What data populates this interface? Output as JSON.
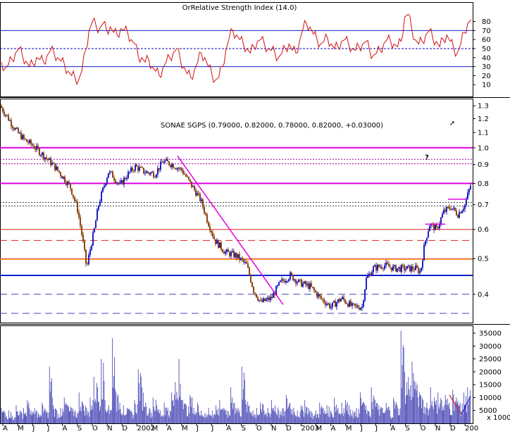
{
  "rsi_panel": {
    "title": "OrRelative Strength Index (14.0)",
    "ticks": [
      "80",
      "70",
      "60",
      "50",
      "40",
      "30",
      "20",
      "10"
    ],
    "tick_values": [
      80,
      70,
      60,
      50,
      40,
      30,
      20,
      10
    ]
  },
  "price_panel": {
    "title": "SONAE SGPS (0.79000, 0.82000, 0.78000, 0.82000, +0.03000)",
    "ticks": [
      "1.3",
      "1.2",
      "1.1",
      "1.0",
      "0.9",
      "0.8",
      "0.7",
      "0.6",
      "0.5",
      "0.4"
    ],
    "tick_values": [
      1.3,
      1.2,
      1.1,
      1.0,
      0.9,
      0.8,
      0.7,
      0.6,
      0.5,
      0.4
    ],
    "question_mark": "?",
    "arrow_glyph": "➚"
  },
  "volume_panel": {
    "ticks": [
      "35000",
      "30000",
      "25000",
      "20000",
      "15000",
      "10000",
      "5000"
    ],
    "tick_values": [
      35000,
      30000,
      25000,
      20000,
      15000,
      10000,
      5000
    ],
    "unit_label": "x 1000"
  },
  "x_axis": {
    "labels": [
      "A",
      "M",
      "J",
      "J",
      "A",
      "S",
      "O",
      "N",
      "D",
      "2002",
      "M",
      "A",
      "M",
      "J",
      "J",
      "A",
      "S",
      "O",
      "N",
      "D",
      "2003",
      "M",
      "A",
      "M",
      "J",
      "J",
      "A",
      "S",
      "O",
      "N",
      "D",
      "200"
    ]
  },
  "chart_data": {
    "type": "candlestick",
    "title": "SONAE SGPS (0.79000, 0.82000, 0.78000, 0.82000, +0.03000)",
    "last_bar": {
      "open": 0.79,
      "high": 0.82,
      "low": 0.78,
      "close": 0.82,
      "change": 0.03
    },
    "price_scale": "log",
    "price_range": [
      0.335,
      1.36
    ],
    "price_path": [
      [
        0,
        1.3
      ],
      [
        12,
        1.2
      ],
      [
        18,
        1.15
      ],
      [
        25,
        1.1
      ],
      [
        35,
        1.05
      ],
      [
        45,
        1.02
      ],
      [
        60,
        0.96
      ],
      [
        75,
        0.9
      ],
      [
        90,
        0.83
      ],
      [
        100,
        0.78
      ],
      [
        110,
        0.68
      ],
      [
        118,
        0.55
      ],
      [
        123,
        0.47
      ],
      [
        128,
        0.53
      ],
      [
        134,
        0.6
      ],
      [
        140,
        0.7
      ],
      [
        147,
        0.78
      ],
      [
        154,
        0.86
      ],
      [
        160,
        0.84
      ],
      [
        170,
        0.79
      ],
      [
        180,
        0.84
      ],
      [
        192,
        0.89
      ],
      [
        205,
        0.86
      ],
      [
        220,
        0.85
      ],
      [
        232,
        0.92
      ],
      [
        245,
        0.9
      ],
      [
        258,
        0.87
      ],
      [
        272,
        0.79
      ],
      [
        285,
        0.72
      ],
      [
        295,
        0.63
      ],
      [
        305,
        0.56
      ],
      [
        320,
        0.52
      ],
      [
        335,
        0.51
      ],
      [
        350,
        0.48
      ],
      [
        360,
        0.41
      ],
      [
        370,
        0.38
      ],
      [
        385,
        0.39
      ],
      [
        398,
        0.43
      ],
      [
        412,
        0.45
      ],
      [
        425,
        0.43
      ],
      [
        440,
        0.42
      ],
      [
        455,
        0.39
      ],
      [
        470,
        0.37
      ],
      [
        485,
        0.39
      ],
      [
        500,
        0.37
      ],
      [
        514,
        0.37
      ],
      [
        520,
        0.44
      ],
      [
        530,
        0.47
      ],
      [
        545,
        0.48
      ],
      [
        560,
        0.47
      ],
      [
        575,
        0.47
      ],
      [
        590,
        0.47
      ],
      [
        597,
        0.46
      ],
      [
        603,
        0.55
      ],
      [
        610,
        0.62
      ],
      [
        620,
        0.6
      ],
      [
        630,
        0.67
      ],
      [
        640,
        0.69
      ],
      [
        650,
        0.66
      ],
      [
        660,
        0.7
      ],
      [
        668,
        0.79
      ],
      [
        671,
        0.82
      ]
    ],
    "horizontal_levels": [
      {
        "value": 1.0,
        "color": "#e000e0",
        "style": "solid",
        "width": 2
      },
      {
        "value": 0.93,
        "color": "#a000a0",
        "style": "dotted",
        "width": 1
      },
      {
        "value": 0.905,
        "color": "#a000a0",
        "style": "dotted",
        "width": 1
      },
      {
        "value": 0.8,
        "color": "#e000e0",
        "style": "solid",
        "width": 2
      },
      {
        "value": 0.71,
        "color": "#404040",
        "style": "dotted",
        "width": 1
      },
      {
        "value": 0.695,
        "color": "#404040",
        "style": "dotted",
        "width": 1
      },
      {
        "value": 0.6,
        "color": "#e02020",
        "style": "solid",
        "width": 1
      },
      {
        "value": 0.56,
        "color": "#e02020",
        "style": "dashed",
        "width": 1
      },
      {
        "value": 0.5,
        "color": "#e04040",
        "style": "solid",
        "width": 1
      },
      {
        "value": 0.497,
        "color": "#ff9900",
        "style": "solid",
        "width": 1
      },
      {
        "value": 0.45,
        "color": "#1020d0",
        "style": "solid",
        "width": 2
      },
      {
        "value": 0.4,
        "color": "#4040c0",
        "style": "dashed",
        "width": 1
      },
      {
        "value": 0.355,
        "color": "#4040c0",
        "style": "dashed",
        "width": 1
      }
    ],
    "trendline": {
      "from": [
        252,
        0.95
      ],
      "to": [
        402,
        0.375
      ],
      "color": "#e000e0"
    },
    "rsi_series": {
      "name": "",
      "range": [
        0,
        100
      ],
      "values": [
        35,
        28,
        32,
        38,
        45,
        50,
        42,
        36,
        30,
        33,
        40,
        38,
        35,
        42,
        48,
        45,
        40,
        36,
        32,
        25,
        20,
        18,
        15,
        26,
        48,
        70,
        80,
        75,
        72,
        78,
        70,
        74,
        68,
        65,
        72,
        70,
        68,
        60,
        55,
        42,
        40,
        35,
        38,
        30,
        25,
        20,
        28,
        35,
        40,
        45,
        50,
        38,
        30,
        22,
        18,
        26,
        35,
        45,
        40,
        30,
        22,
        15,
        18,
        30,
        48,
        62,
        70,
        65,
        60,
        55,
        50,
        45,
        52,
        58,
        60,
        55,
        50,
        48,
        45,
        40,
        45,
        50,
        55,
        48,
        45,
        58,
        72,
        78,
        74,
        66,
        60,
        55,
        58,
        62,
        55,
        50,
        52,
        58,
        60,
        55,
        50,
        48,
        52,
        55,
        58,
        48,
        42,
        45,
        48,
        55,
        60,
        58,
        55,
        52,
        58,
        85,
        88,
        72,
        60,
        55,
        58,
        65,
        70,
        62,
        58,
        52,
        60,
        65,
        58,
        50,
        45,
        55,
        68,
        78,
        82
      ]
    },
    "rsi_levels": [
      70,
      50,
      30
    ],
    "volume_series": {
      "name": "",
      "values": [
        6,
        4,
        5,
        3,
        7,
        5,
        6,
        9,
        5,
        6,
        4,
        8,
        5,
        22,
        7,
        5,
        6,
        10,
        7,
        6,
        5,
        12,
        8,
        6,
        10,
        18,
        14,
        25,
        9,
        7,
        33,
        12,
        8,
        7,
        6,
        5,
        9,
        21,
        14,
        8,
        6,
        10,
        7,
        5,
        8,
        6,
        12,
        16,
        25,
        9,
        7,
        11,
        6,
        8,
        5,
        4,
        6,
        5,
        7,
        9,
        6,
        5,
        14,
        8,
        6,
        22,
        9,
        7,
        5,
        6,
        8,
        5,
        6,
        9,
        7,
        5,
        6,
        11,
        8,
        6,
        5,
        7,
        9,
        6,
        4,
        5,
        8,
        6,
        7,
        5,
        10,
        6,
        8,
        9,
        7,
        5,
        6,
        12,
        8,
        5,
        14,
        9,
        7,
        6,
        8,
        5,
        10,
        7,
        36,
        20,
        18,
        24,
        16,
        12,
        9,
        8,
        14,
        10,
        12,
        9,
        11,
        8,
        13,
        10,
        8,
        12,
        14
      ]
    }
  }
}
